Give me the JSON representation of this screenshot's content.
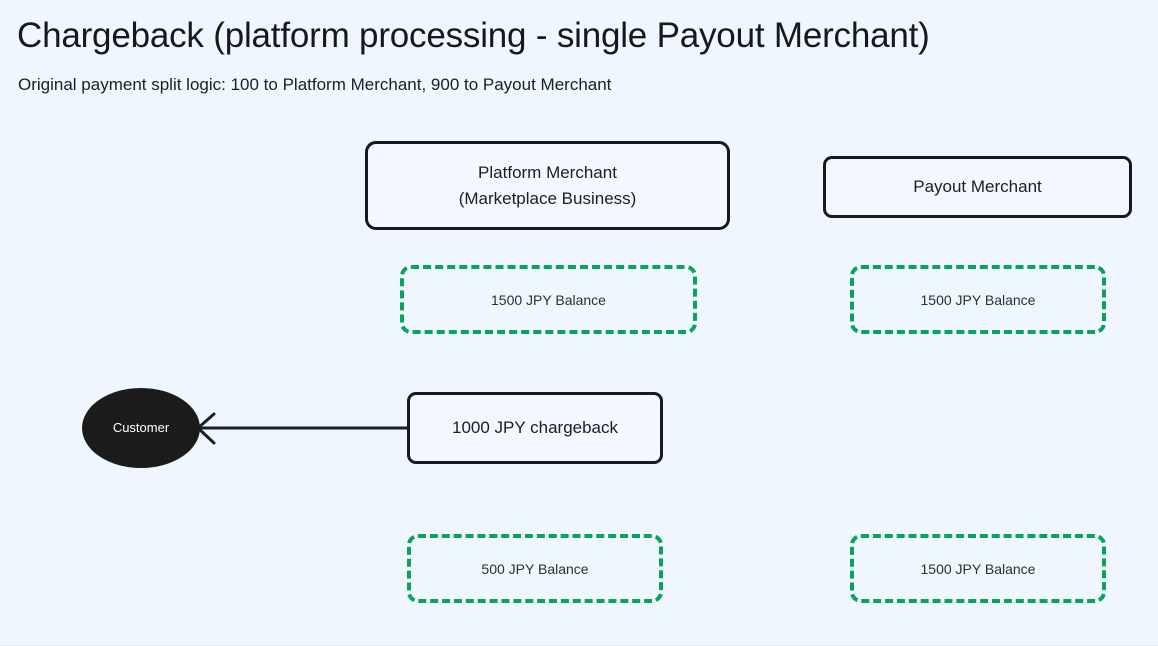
{
  "header": {
    "title": "Chargeback (platform processing - single Payout Merchant)",
    "subtitle": "Original payment split logic: 100 to Platform Merchant, 900 to Payout Merchant"
  },
  "colors": {
    "background": "#f0f6fe",
    "node_stroke": "#16191d",
    "node_fill": "#f3f8fe",
    "balance_stroke": "#0aa35a",
    "customer_fill": "#1b1b1b",
    "customer_text": "#ffffff",
    "edge_stroke": "#1b1f24"
  },
  "nodes": {
    "platform_merchant": {
      "line1": "Platform Merchant",
      "line2": "(Marketplace Business)"
    },
    "payout_merchant": {
      "label": "Payout Merchant"
    },
    "chargeback": {
      "label": "1000 JPY chargeback"
    },
    "customer": {
      "label": "Customer"
    }
  },
  "balances": {
    "platform_before": "1500 JPY Balance",
    "payout_before": "1500 JPY Balance",
    "platform_after": "500 JPY Balance",
    "payout_after": "1500 JPY Balance"
  },
  "edges": [
    {
      "name": "chargeback-to-customer",
      "from": "1000 JPY chargeback",
      "to": "Customer",
      "arrowhead": "open-chevron-left"
    }
  ]
}
